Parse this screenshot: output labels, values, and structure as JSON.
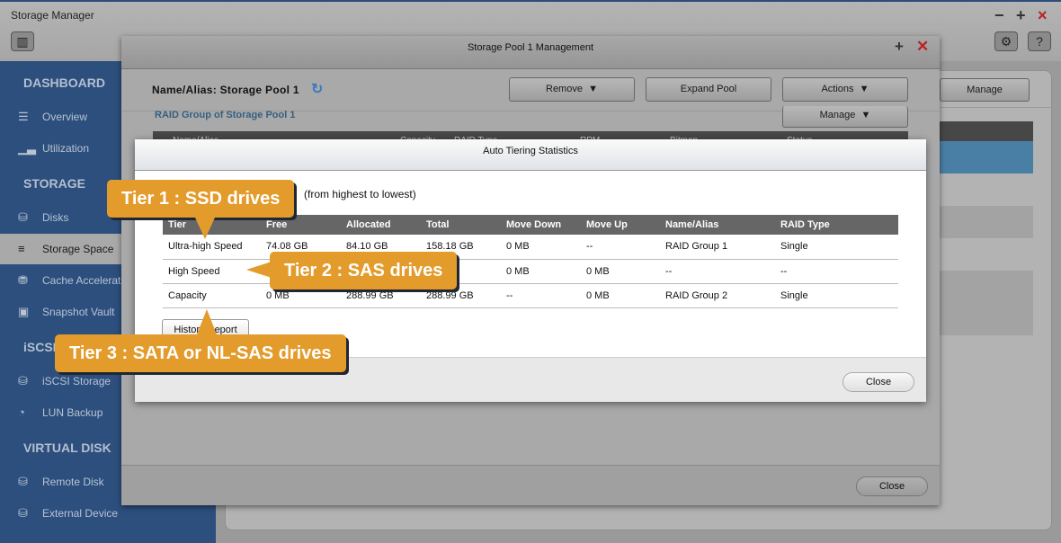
{
  "app": {
    "title": "Storage Manager",
    "controls": [
      "−",
      "+",
      "×"
    ]
  },
  "toolbar": {
    "settings_icon": "gear-icon",
    "help_label": "?"
  },
  "sidebar": {
    "sections": [
      {
        "label": "DASHBOARD",
        "items": [
          {
            "label": "Overview",
            "icon": "list-icon"
          },
          {
            "label": "Utilization",
            "icon": "chart-icon"
          }
        ]
      },
      {
        "label": "STORAGE",
        "items": [
          {
            "label": "Disks",
            "icon": "disk-icon"
          },
          {
            "label": "Storage Space",
            "icon": "storage-icon",
            "active": true
          },
          {
            "label": "Cache Acceleration",
            "icon": "cache-icon"
          },
          {
            "label": "Snapshot Vault",
            "icon": "snapshot-icon"
          }
        ]
      },
      {
        "label": "iSCSI",
        "items": [
          {
            "label": "iSCSI Storage",
            "icon": "iscsi-icon"
          },
          {
            "label": "LUN Backup",
            "icon": "backup-icon"
          }
        ]
      },
      {
        "label": "VIRTUAL DISK",
        "items": [
          {
            "label": "Remote Disk",
            "icon": "remote-disk-icon"
          },
          {
            "label": "External Device",
            "icon": "external-device-icon"
          }
        ]
      }
    ]
  },
  "main": {
    "manage_label": "Manage",
    "selected_row_color": "#4a7fa5"
  },
  "pool_dialog": {
    "title": "Storage Pool 1 Management",
    "name_alias": "Name/Alias: Storage Pool 1",
    "remove_label": "Remove",
    "expand_label": "Expand Pool",
    "actions_label": "Actions",
    "raid_group_title": "RAID Group of Storage Pool 1",
    "manage_label": "Manage",
    "columns": [
      "Name/Alias",
      "Capacity",
      "RAID Type",
      "RPM",
      "Bitmap",
      "Status"
    ],
    "close_label": "Close"
  },
  "tiering_dialog": {
    "title": "Auto Tiering Statistics",
    "subtitle": "(from highest to lowest)",
    "columns": [
      "Tier",
      "Free",
      "Allocated",
      "Total",
      "Move Down",
      "Move Up",
      "Name/Alias",
      "RAID Type"
    ],
    "rows": [
      [
        "Ultra-high Speed",
        "74.08 GB",
        "84.10 GB",
        "158.18 GB",
        "0 MB",
        "--",
        "RAID Group 1",
        "Single"
      ],
      [
        "High Speed",
        "",
        "",
        "",
        "0 MB",
        "0 MB",
        "--",
        "--"
      ],
      [
        "Capacity",
        "0 MB",
        "288.99 GB",
        "288.99 GB",
        "--",
        "0 MB",
        "RAID Group 2",
        "Single"
      ]
    ],
    "history_label": "History Report",
    "close_label": "Close"
  },
  "callouts": {
    "tier1": "Tier 1 : SSD drives",
    "tier2": "Tier 2 : SAS drives",
    "tier3": "Tier 3 : SATA or NL-SAS drives",
    "color": "#e39b2b"
  }
}
